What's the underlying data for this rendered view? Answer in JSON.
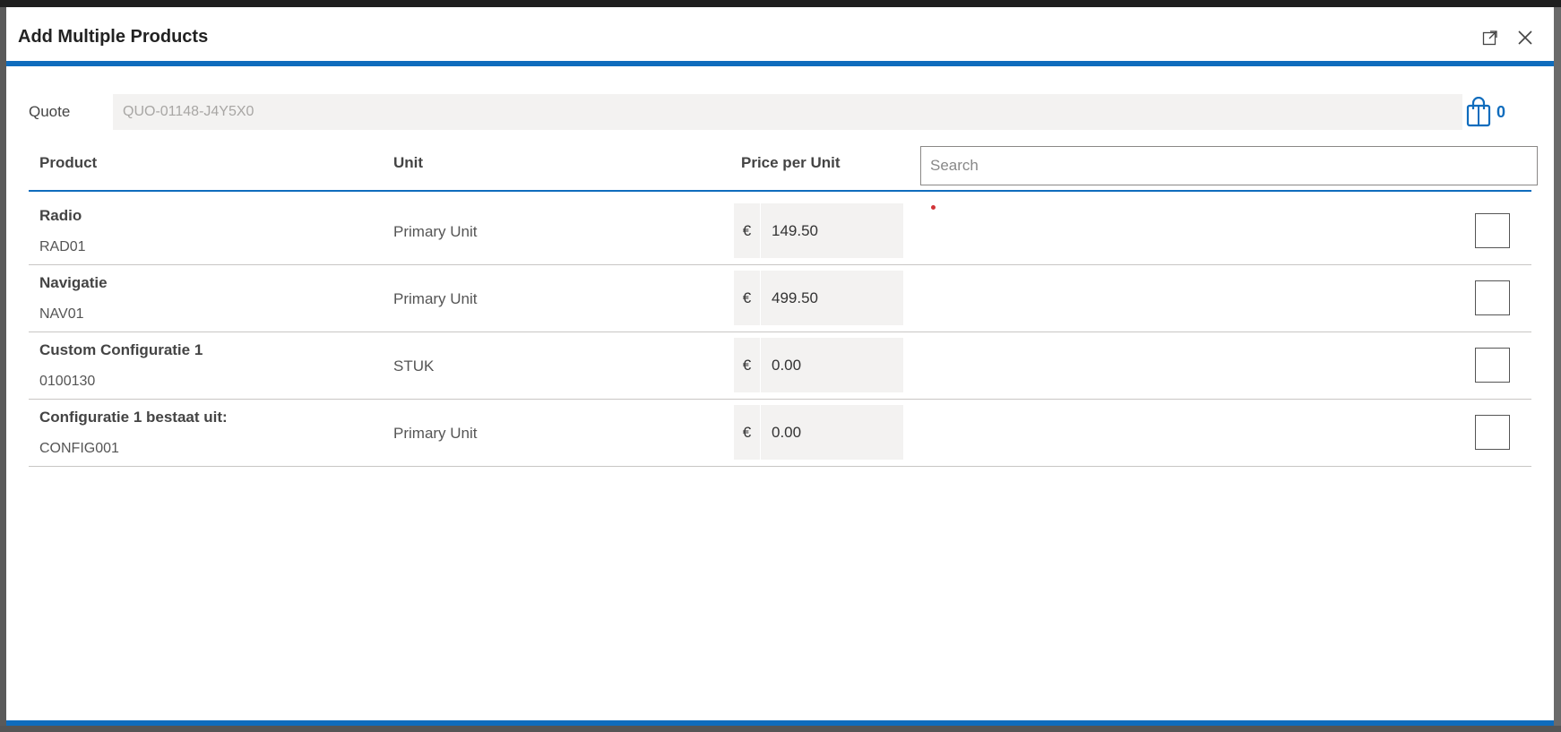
{
  "dialog": {
    "title": "Add Multiple Products",
    "expand_icon": "expand-icon",
    "close_icon": "close-icon"
  },
  "quote": {
    "label": "Quote",
    "value": "QUO-01148-J4Y5X0"
  },
  "cart": {
    "icon": "shopping-bag-icon",
    "count": "0"
  },
  "table": {
    "headers": {
      "product": "Product",
      "unit": "Unit",
      "price": "Price per Unit"
    },
    "search_placeholder": "Search",
    "rows": [
      {
        "name": "Radio",
        "code": "RAD01",
        "unit": "Primary Unit",
        "currency": "€",
        "price": "149.50"
      },
      {
        "name": "Navigatie",
        "code": "NAV01",
        "unit": "Primary Unit",
        "currency": "€",
        "price": "499.50"
      },
      {
        "name": "Custom Configuratie 1",
        "code": "0100130",
        "unit": "STUK",
        "currency": "€",
        "price": "0.00"
      },
      {
        "name": "Configuratie 1 bestaat uit:",
        "code": "CONFIG001",
        "unit": "Primary Unit",
        "currency": "€",
        "price": "0.00"
      }
    ]
  },
  "colors": {
    "accent": "#0f6cbd",
    "input_bg": "#f3f2f1"
  }
}
